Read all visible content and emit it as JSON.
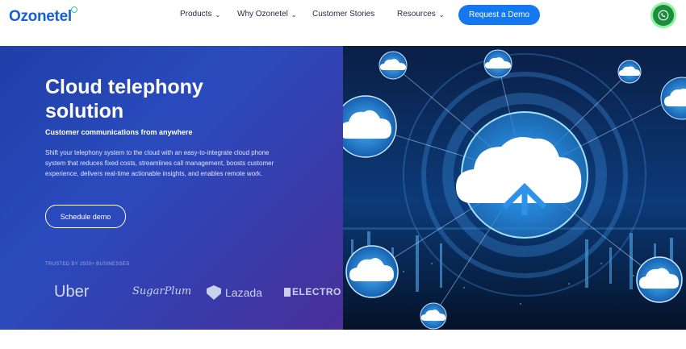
{
  "nav": {
    "logo": "Ozonetel",
    "items": [
      {
        "label": "Products",
        "has_chevron": true
      },
      {
        "label": "Why Ozonetel",
        "has_chevron": true
      },
      {
        "label": "Customer Stories",
        "has_chevron": false
      },
      {
        "label": "Resources",
        "has_chevron": true
      }
    ],
    "cta_label": "Request a Demo"
  },
  "hero": {
    "title_line1": "Cloud telephony",
    "title_line2": "solution",
    "subtitle": "Customer communications from anywhere",
    "description": "Shift your telephony system to the cloud with an easy-to-integrate cloud phone system that reduces fixed costs, streamlines call management, boosts customer experience, delivers real-time actionable insights, and enables remote work.",
    "button_label": "Schedule demo",
    "trusted_label": "TRUSTED BY 2500+ BUSINESSES",
    "brands": [
      "Uber",
      "SugarPlum",
      "Lazada",
      "ELECTRO"
    ]
  },
  "colors": {
    "brand_blue": "#1479f0",
    "logo_blue": "#1560d6",
    "hero_bg": "#2a4bbd",
    "whatsapp_green": "#1c8e3b"
  }
}
